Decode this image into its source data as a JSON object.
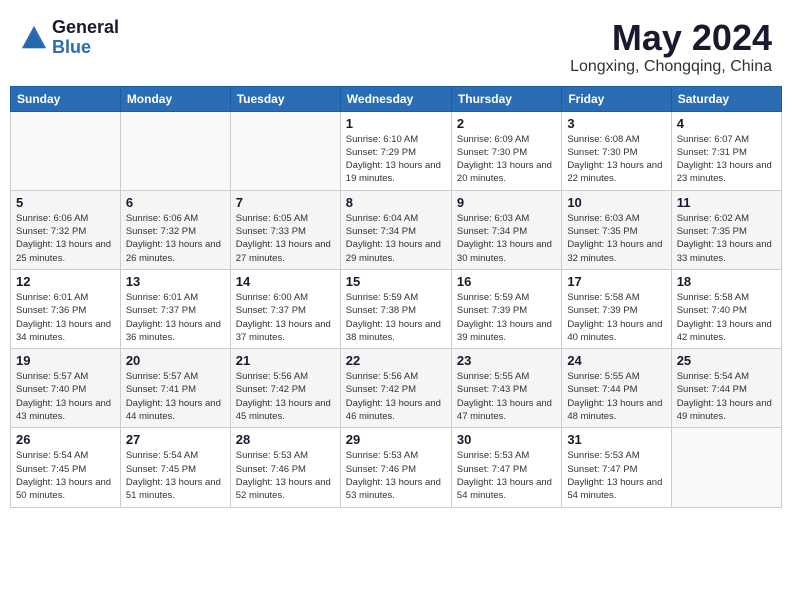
{
  "header": {
    "logo_general": "General",
    "logo_blue": "Blue",
    "month_year": "May 2024",
    "location": "Longxing, Chongqing, China"
  },
  "calendar": {
    "days_of_week": [
      "Sunday",
      "Monday",
      "Tuesday",
      "Wednesday",
      "Thursday",
      "Friday",
      "Saturday"
    ],
    "weeks": [
      [
        {
          "day": "",
          "info": ""
        },
        {
          "day": "",
          "info": ""
        },
        {
          "day": "",
          "info": ""
        },
        {
          "day": "1",
          "info": "Sunrise: 6:10 AM\nSunset: 7:29 PM\nDaylight: 13 hours\nand 19 minutes."
        },
        {
          "day": "2",
          "info": "Sunrise: 6:09 AM\nSunset: 7:30 PM\nDaylight: 13 hours\nand 20 minutes."
        },
        {
          "day": "3",
          "info": "Sunrise: 6:08 AM\nSunset: 7:30 PM\nDaylight: 13 hours\nand 22 minutes."
        },
        {
          "day": "4",
          "info": "Sunrise: 6:07 AM\nSunset: 7:31 PM\nDaylight: 13 hours\nand 23 minutes."
        }
      ],
      [
        {
          "day": "5",
          "info": "Sunrise: 6:06 AM\nSunset: 7:32 PM\nDaylight: 13 hours\nand 25 minutes."
        },
        {
          "day": "6",
          "info": "Sunrise: 6:06 AM\nSunset: 7:32 PM\nDaylight: 13 hours\nand 26 minutes."
        },
        {
          "day": "7",
          "info": "Sunrise: 6:05 AM\nSunset: 7:33 PM\nDaylight: 13 hours\nand 27 minutes."
        },
        {
          "day": "8",
          "info": "Sunrise: 6:04 AM\nSunset: 7:34 PM\nDaylight: 13 hours\nand 29 minutes."
        },
        {
          "day": "9",
          "info": "Sunrise: 6:03 AM\nSunset: 7:34 PM\nDaylight: 13 hours\nand 30 minutes."
        },
        {
          "day": "10",
          "info": "Sunrise: 6:03 AM\nSunset: 7:35 PM\nDaylight: 13 hours\nand 32 minutes."
        },
        {
          "day": "11",
          "info": "Sunrise: 6:02 AM\nSunset: 7:35 PM\nDaylight: 13 hours\nand 33 minutes."
        }
      ],
      [
        {
          "day": "12",
          "info": "Sunrise: 6:01 AM\nSunset: 7:36 PM\nDaylight: 13 hours\nand 34 minutes."
        },
        {
          "day": "13",
          "info": "Sunrise: 6:01 AM\nSunset: 7:37 PM\nDaylight: 13 hours\nand 36 minutes."
        },
        {
          "day": "14",
          "info": "Sunrise: 6:00 AM\nSunset: 7:37 PM\nDaylight: 13 hours\nand 37 minutes."
        },
        {
          "day": "15",
          "info": "Sunrise: 5:59 AM\nSunset: 7:38 PM\nDaylight: 13 hours\nand 38 minutes."
        },
        {
          "day": "16",
          "info": "Sunrise: 5:59 AM\nSunset: 7:39 PM\nDaylight: 13 hours\nand 39 minutes."
        },
        {
          "day": "17",
          "info": "Sunrise: 5:58 AM\nSunset: 7:39 PM\nDaylight: 13 hours\nand 40 minutes."
        },
        {
          "day": "18",
          "info": "Sunrise: 5:58 AM\nSunset: 7:40 PM\nDaylight: 13 hours\nand 42 minutes."
        }
      ],
      [
        {
          "day": "19",
          "info": "Sunrise: 5:57 AM\nSunset: 7:40 PM\nDaylight: 13 hours\nand 43 minutes."
        },
        {
          "day": "20",
          "info": "Sunrise: 5:57 AM\nSunset: 7:41 PM\nDaylight: 13 hours\nand 44 minutes."
        },
        {
          "day": "21",
          "info": "Sunrise: 5:56 AM\nSunset: 7:42 PM\nDaylight: 13 hours\nand 45 minutes."
        },
        {
          "day": "22",
          "info": "Sunrise: 5:56 AM\nSunset: 7:42 PM\nDaylight: 13 hours\nand 46 minutes."
        },
        {
          "day": "23",
          "info": "Sunrise: 5:55 AM\nSunset: 7:43 PM\nDaylight: 13 hours\nand 47 minutes."
        },
        {
          "day": "24",
          "info": "Sunrise: 5:55 AM\nSunset: 7:44 PM\nDaylight: 13 hours\nand 48 minutes."
        },
        {
          "day": "25",
          "info": "Sunrise: 5:54 AM\nSunset: 7:44 PM\nDaylight: 13 hours\nand 49 minutes."
        }
      ],
      [
        {
          "day": "26",
          "info": "Sunrise: 5:54 AM\nSunset: 7:45 PM\nDaylight: 13 hours\nand 50 minutes."
        },
        {
          "day": "27",
          "info": "Sunrise: 5:54 AM\nSunset: 7:45 PM\nDaylight: 13 hours\nand 51 minutes."
        },
        {
          "day": "28",
          "info": "Sunrise: 5:53 AM\nSunset: 7:46 PM\nDaylight: 13 hours\nand 52 minutes."
        },
        {
          "day": "29",
          "info": "Sunrise: 5:53 AM\nSunset: 7:46 PM\nDaylight: 13 hours\nand 53 minutes."
        },
        {
          "day": "30",
          "info": "Sunrise: 5:53 AM\nSunset: 7:47 PM\nDaylight: 13 hours\nand 54 minutes."
        },
        {
          "day": "31",
          "info": "Sunrise: 5:53 AM\nSunset: 7:47 PM\nDaylight: 13 hours\nand 54 minutes."
        },
        {
          "day": "",
          "info": ""
        }
      ]
    ]
  }
}
